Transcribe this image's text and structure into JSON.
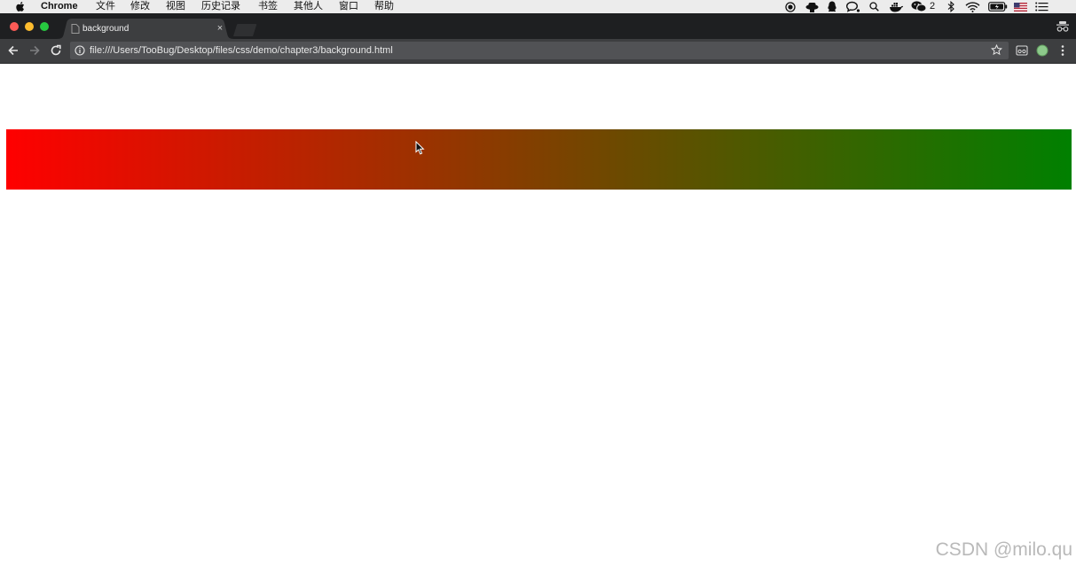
{
  "menubar": {
    "app_name": "Chrome",
    "menus": [
      "文件",
      "修改",
      "视图",
      "历史记录",
      "书签",
      "其他人",
      "窗口",
      "帮助"
    ],
    "wechat_count": "2",
    "tray_icons": [
      "record-icon",
      "hat-icon",
      "qq-icon",
      "chat-icon",
      "search-icon",
      "docker-icon",
      "wechat-icon",
      "bluetooth-icon",
      "wifi-icon",
      "battery-icon",
      "flag-us-icon",
      "list-icon"
    ]
  },
  "browser": {
    "tab_title": "background",
    "tab_close": "×",
    "url": "file:///Users/TooBug/Desktop/files/css/demo/chapter3/background.html"
  },
  "page": {
    "gradient_from": "#ff0000",
    "gradient_to": "#008000",
    "gradient_direction": "to right"
  },
  "watermark": "CSDN @milo.qu"
}
